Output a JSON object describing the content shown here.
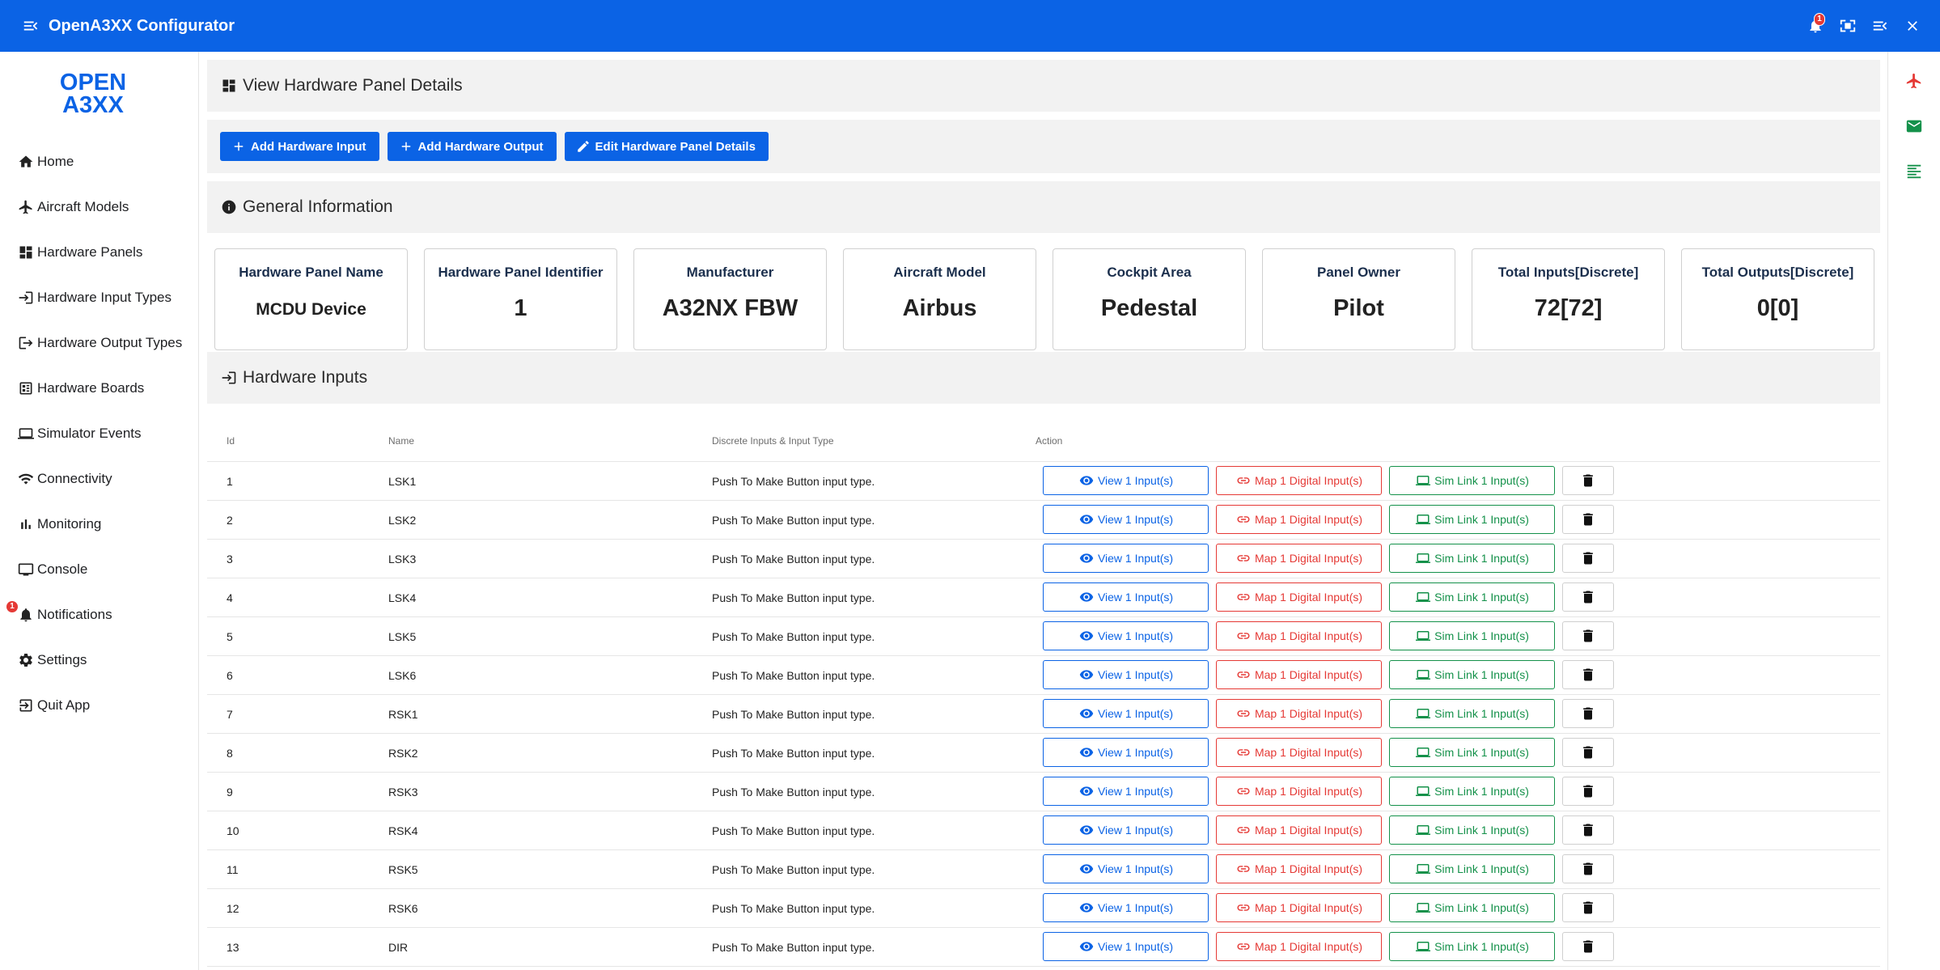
{
  "app": {
    "title": "OpenA3XX Configurator",
    "notification_count": "1",
    "logo_top": "OPEN",
    "logo_bottom": "A3XX"
  },
  "colors": {
    "primary": "#0b63e5",
    "danger": "#e53935",
    "success": "#14914a",
    "section_bg": "#f2f2f2"
  },
  "sidebar": {
    "items": [
      {
        "label": "Home",
        "icon": "home-icon"
      },
      {
        "label": "Aircraft Models",
        "icon": "airplane-icon"
      },
      {
        "label": "Hardware Panels",
        "icon": "dashboard-icon"
      },
      {
        "label": "Hardware Input Types",
        "icon": "login-icon"
      },
      {
        "label": "Hardware Output Types",
        "icon": "logout-icon"
      },
      {
        "label": "Hardware Boards",
        "icon": "board-icon"
      },
      {
        "label": "Simulator Events",
        "icon": "laptop-icon"
      },
      {
        "label": "Connectivity",
        "icon": "wifi-icon"
      },
      {
        "label": "Monitoring",
        "icon": "bar-chart-icon"
      },
      {
        "label": "Console",
        "icon": "console-icon"
      },
      {
        "label": "Notifications",
        "icon": "bell-icon",
        "badge": "1"
      },
      {
        "label": "Settings",
        "icon": "gear-icon"
      },
      {
        "label": "Quit App",
        "icon": "exit-icon"
      }
    ]
  },
  "page": {
    "title": "View Hardware Panel Details",
    "buttons": {
      "add_input": "Add Hardware Input",
      "add_output": "Add Hardware Output",
      "edit": "Edit Hardware Panel Details"
    },
    "general_title": "General Information",
    "cards": [
      {
        "label": "Hardware Panel Name",
        "value": "MCDU Device"
      },
      {
        "label": "Hardware Panel Identifier",
        "value": "1"
      },
      {
        "label": "Manufacturer",
        "value": "A32NX FBW"
      },
      {
        "label": "Aircraft Model",
        "value": "Airbus"
      },
      {
        "label": "Cockpit Area",
        "value": "Pedestal"
      },
      {
        "label": "Panel Owner",
        "value": "Pilot"
      },
      {
        "label": "Total Inputs[Discrete]",
        "value": "72[72]"
      },
      {
        "label": "Total Outputs[Discrete]",
        "value": "0[0]"
      }
    ],
    "inputs_title": "Hardware Inputs"
  },
  "table": {
    "headers": {
      "id": "Id",
      "name": "Name",
      "type": "Discrete Inputs & Input Type",
      "action": "Action"
    },
    "action_labels": {
      "view": "View 1 Input(s)",
      "map": "Map 1 Digital Input(s)",
      "sim": "Sim Link 1 Input(s)"
    },
    "rows": [
      {
        "id": "1",
        "name": "LSK1",
        "type": "Push To Make Button input type."
      },
      {
        "id": "2",
        "name": "LSK2",
        "type": "Push To Make Button input type."
      },
      {
        "id": "3",
        "name": "LSK3",
        "type": "Push To Make Button input type."
      },
      {
        "id": "4",
        "name": "LSK4",
        "type": "Push To Make Button input type."
      },
      {
        "id": "5",
        "name": "LSK5",
        "type": "Push To Make Button input type."
      },
      {
        "id": "6",
        "name": "LSK6",
        "type": "Push To Make Button input type."
      },
      {
        "id": "7",
        "name": "RSK1",
        "type": "Push To Make Button input type."
      },
      {
        "id": "8",
        "name": "RSK2",
        "type": "Push To Make Button input type."
      },
      {
        "id": "9",
        "name": "RSK3",
        "type": "Push To Make Button input type."
      },
      {
        "id": "10",
        "name": "RSK4",
        "type": "Push To Make Button input type."
      },
      {
        "id": "11",
        "name": "RSK5",
        "type": "Push To Make Button input type."
      },
      {
        "id": "12",
        "name": "RSK6",
        "type": "Push To Make Button input type."
      },
      {
        "id": "13",
        "name": "DIR",
        "type": "Push To Make Button input type."
      }
    ]
  }
}
